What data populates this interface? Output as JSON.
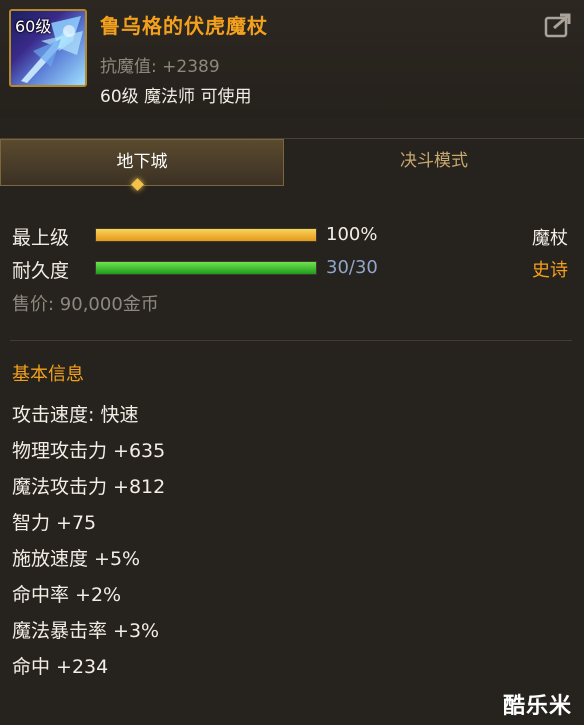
{
  "item": {
    "level_badge": "60级",
    "name": "鲁乌格的伏虎魔杖",
    "resist": "抗魔值: +2389",
    "requirement": "60级 魔法师 可使用",
    "icon": "magic-staff-icon",
    "share_icon": "share-icon"
  },
  "tabs": [
    {
      "label": "地下城",
      "active": true
    },
    {
      "label": "决斗模式",
      "active": false
    }
  ],
  "stats": {
    "upgrade": {
      "label": "最上级",
      "value": "100%",
      "fill": 1.0,
      "color": "#f0b63a"
    },
    "durability": {
      "label": "耐久度",
      "value": "30/30",
      "fill": 1.0,
      "color": "#3ec432"
    }
  },
  "weapon_type": "魔杖",
  "rarity": "史诗",
  "price": "售价: 90,000金币",
  "section_title": "基本信息",
  "attributes": [
    "攻击速度: 快速",
    "物理攻击力 +635",
    "魔法攻击力 +812",
    "智力 +75",
    "施放速度 +5%",
    "命中率 +2%",
    "魔法暴击率 +3%",
    "命中 +234"
  ],
  "watermark": "酷乐米",
  "colors": {
    "title": "#f3a11c",
    "rarity": "#f3a11c",
    "durability_value": "#8fa6c8"
  }
}
